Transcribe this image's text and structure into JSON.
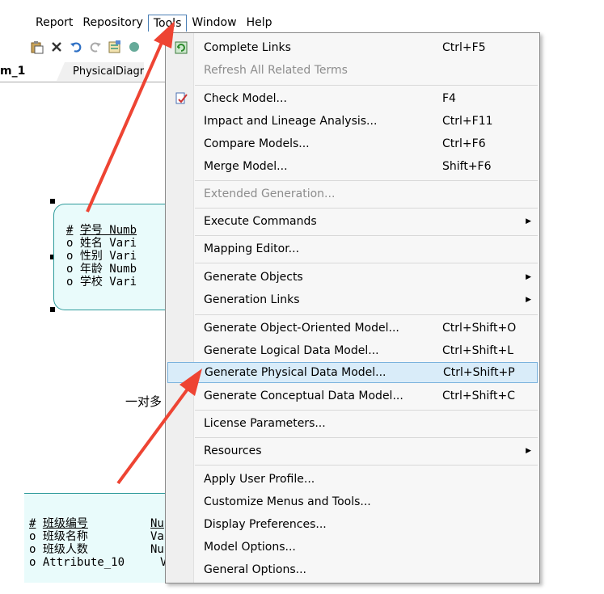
{
  "menubar": {
    "items": [
      "Report",
      "Repository",
      "Tools",
      "Window",
      "Help"
    ]
  },
  "tabs": {
    "active": "m_1",
    "other": "PhysicalDiagr"
  },
  "entity1": {
    "rows": [
      {
        "mark": "#",
        "text": "学号 Numb"
      },
      {
        "mark": "o",
        "text": "姓名 Vari"
      },
      {
        "mark": "o",
        "text": "性别 Vari"
      },
      {
        "mark": "o",
        "text": "年龄 Numb"
      },
      {
        "mark": "o",
        "text": "学校 Vari"
      }
    ]
  },
  "relationship_label": "一对多",
  "entity2": {
    "rows": [
      {
        "mark": "#",
        "name": "班级编号",
        "type": "Nu"
      },
      {
        "mark": "o",
        "name": "班级名称",
        "type": "Va"
      },
      {
        "mark": "o",
        "name": "班级人数",
        "type": "Nu"
      },
      {
        "mark": "o",
        "name": "Attribute_10",
        "type": "Va"
      }
    ]
  },
  "menu": {
    "items": [
      {
        "label": "Complete Links",
        "shortcut": "Ctrl+F5"
      },
      {
        "label": "Refresh All Related Terms",
        "shortcut": ""
      },
      {
        "label": "Check Model...",
        "shortcut": "F4"
      },
      {
        "label": "Impact and Lineage Analysis...",
        "shortcut": "Ctrl+F11"
      },
      {
        "label": "Compare Models...",
        "shortcut": "Ctrl+F6"
      },
      {
        "label": "Merge Model...",
        "shortcut": "Shift+F6"
      },
      {
        "label": "Extended Generation...",
        "shortcut": ""
      },
      {
        "label": "Execute Commands",
        "shortcut": ""
      },
      {
        "label": "Mapping Editor...",
        "shortcut": ""
      },
      {
        "label": "Generate Objects",
        "shortcut": ""
      },
      {
        "label": "Generation Links",
        "shortcut": ""
      },
      {
        "label": "Generate Object-Oriented Model...",
        "shortcut": "Ctrl+Shift+O"
      },
      {
        "label": "Generate Logical Data Model...",
        "shortcut": "Ctrl+Shift+L"
      },
      {
        "label": "Generate Physical Data Model...",
        "shortcut": "Ctrl+Shift+P"
      },
      {
        "label": "Generate Conceptual Data Model...",
        "shortcut": "Ctrl+Shift+C"
      },
      {
        "label": "License Parameters...",
        "shortcut": ""
      },
      {
        "label": "Resources",
        "shortcut": ""
      },
      {
        "label": "Apply User Profile...",
        "shortcut": ""
      },
      {
        "label": "Customize Menus and Tools...",
        "shortcut": ""
      },
      {
        "label": "Display Preferences...",
        "shortcut": ""
      },
      {
        "label": "Model Options...",
        "shortcut": ""
      },
      {
        "label": "General Options...",
        "shortcut": ""
      }
    ]
  },
  "colors": {
    "highlight_bg": "#d9ecf9",
    "highlight_border": "#7ab2dd",
    "entity_fill": "#e9fbfb",
    "entity_border": "#2e9b9b",
    "annotation_arrow": "#ee4433"
  }
}
